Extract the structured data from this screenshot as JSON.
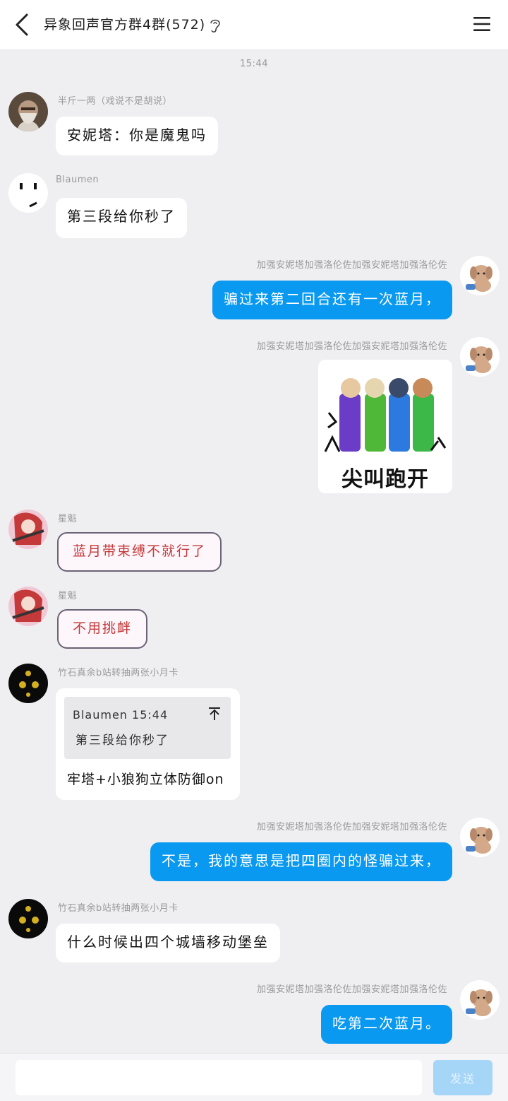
{
  "header": {
    "back_icon": "chevron-left-icon",
    "title": "异象回声官方群4群(572)",
    "ear_icon": "ear-icon",
    "menu_icon": "hamburger-menu-icon"
  },
  "timestamp": "15:44",
  "messages": [
    {
      "sender": "半斤一两（戏说不是胡说）",
      "text": "安妮塔：你是魔鬼吗",
      "direction": "in"
    },
    {
      "sender": "Blaumen",
      "text": "第三段给你秒了",
      "direction": "in"
    },
    {
      "sender": "加强安妮塔加强洛伦佐加强安妮塔加强洛伦佐",
      "text": "骗过来第二回合还有一次蓝月，",
      "direction": "out"
    },
    {
      "sender": "加强安妮塔加强洛伦佐加强安妮塔加强洛伦佐",
      "sticker_caption": "尖叫跑开",
      "direction": "out"
    },
    {
      "sender": "星魁",
      "text": "蓝月带束缚不就行了",
      "direction": "in"
    },
    {
      "sender": "星魁",
      "text": "不用挑衅",
      "direction": "in"
    },
    {
      "sender": "竹石真余b站转抽两张小月卡",
      "quote_meta": "Blaumen 15:44",
      "quote_text": "第三段给你秒了",
      "text": "牢塔+小狼狗立体防御on",
      "direction": "in"
    },
    {
      "sender": "加强安妮塔加强洛伦佐加强安妮塔加强洛伦佐",
      "text": "不是，我的意思是把四圈内的怪骗过来，",
      "direction": "out"
    },
    {
      "sender": "竹石真余b站转抽两张小月卡",
      "text": "什么时候出四个城墙移动堡垒",
      "direction": "in"
    },
    {
      "sender": "加强安妮塔加强洛伦佐加强安妮塔加强洛伦佐",
      "text": "吃第二次蓝月。",
      "direction": "out"
    }
  ],
  "input": {
    "placeholder": "",
    "value": ""
  },
  "send_label": "发送",
  "colors": {
    "accent": "#0a99f0",
    "bubble_in": "#ffffff",
    "background": "#efeff2"
  }
}
